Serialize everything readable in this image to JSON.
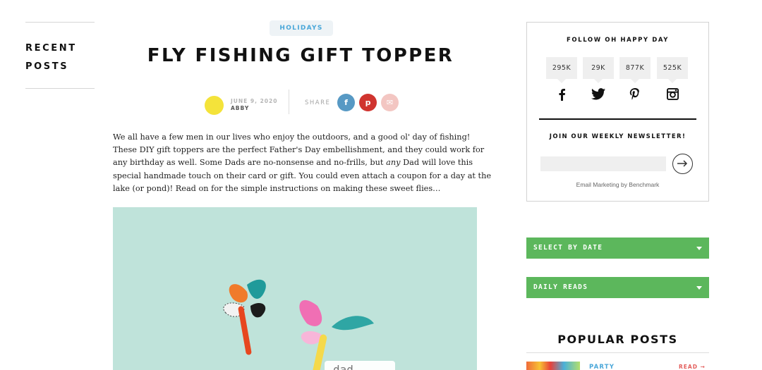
{
  "sidebar_left": {
    "recent_posts_title": "RECENT POSTS"
  },
  "post": {
    "category": "HOLIDAYS",
    "title": "FLY FISHING GIFT TOPPER",
    "date": "JUNE 9, 2020",
    "author": "ABBY",
    "share_label": "SHARE",
    "share_buttons": [
      "f",
      "p",
      "✉"
    ],
    "intro_part1": "We all have a few men in our lives who enjoy the outdoors, and a good ol' day of fishing! These DIY gift toppers are the perfect Father's Day embellishment, and they could work for any birthday as well. Some Dads are no-nonsense and no-frills, but ",
    "intro_emphasis": "any",
    "intro_part2": " Dad will love this special handmade touch on their card or gift. You could even attach a coupon for a day at the lake (or pond)! Read on for the simple instructions on making these sweet flies…",
    "hero_tag_text": "dad",
    "hero_bg_color": "#bfe3da"
  },
  "follow": {
    "title": "FOLLOW OH HAPPY DAY",
    "networks": [
      {
        "count": "295K",
        "icon": "facebook-icon"
      },
      {
        "count": "29K",
        "icon": "twitter-icon"
      },
      {
        "count": "877K",
        "icon": "pinterest-icon"
      },
      {
        "count": "525K",
        "icon": "instagram-icon"
      }
    ],
    "newsletter_title": "JOIN OUR WEEKLY NEWSLETTER!",
    "email_placeholder": "",
    "powered_by": "Email Marketing by Benchmark"
  },
  "dropdowns": {
    "select_by_date": "SELECT BY DATE",
    "daily_reads": "DAILY READS"
  },
  "popular": {
    "title": "POPULAR POSTS",
    "first_category": "PARTY",
    "first_read": "READ →"
  },
  "colors": {
    "accent_blue": "#4aa7d9",
    "accent_green": "#5cb75c",
    "accent_red": "#e35d5b",
    "author_dot": "#f4e33a"
  }
}
